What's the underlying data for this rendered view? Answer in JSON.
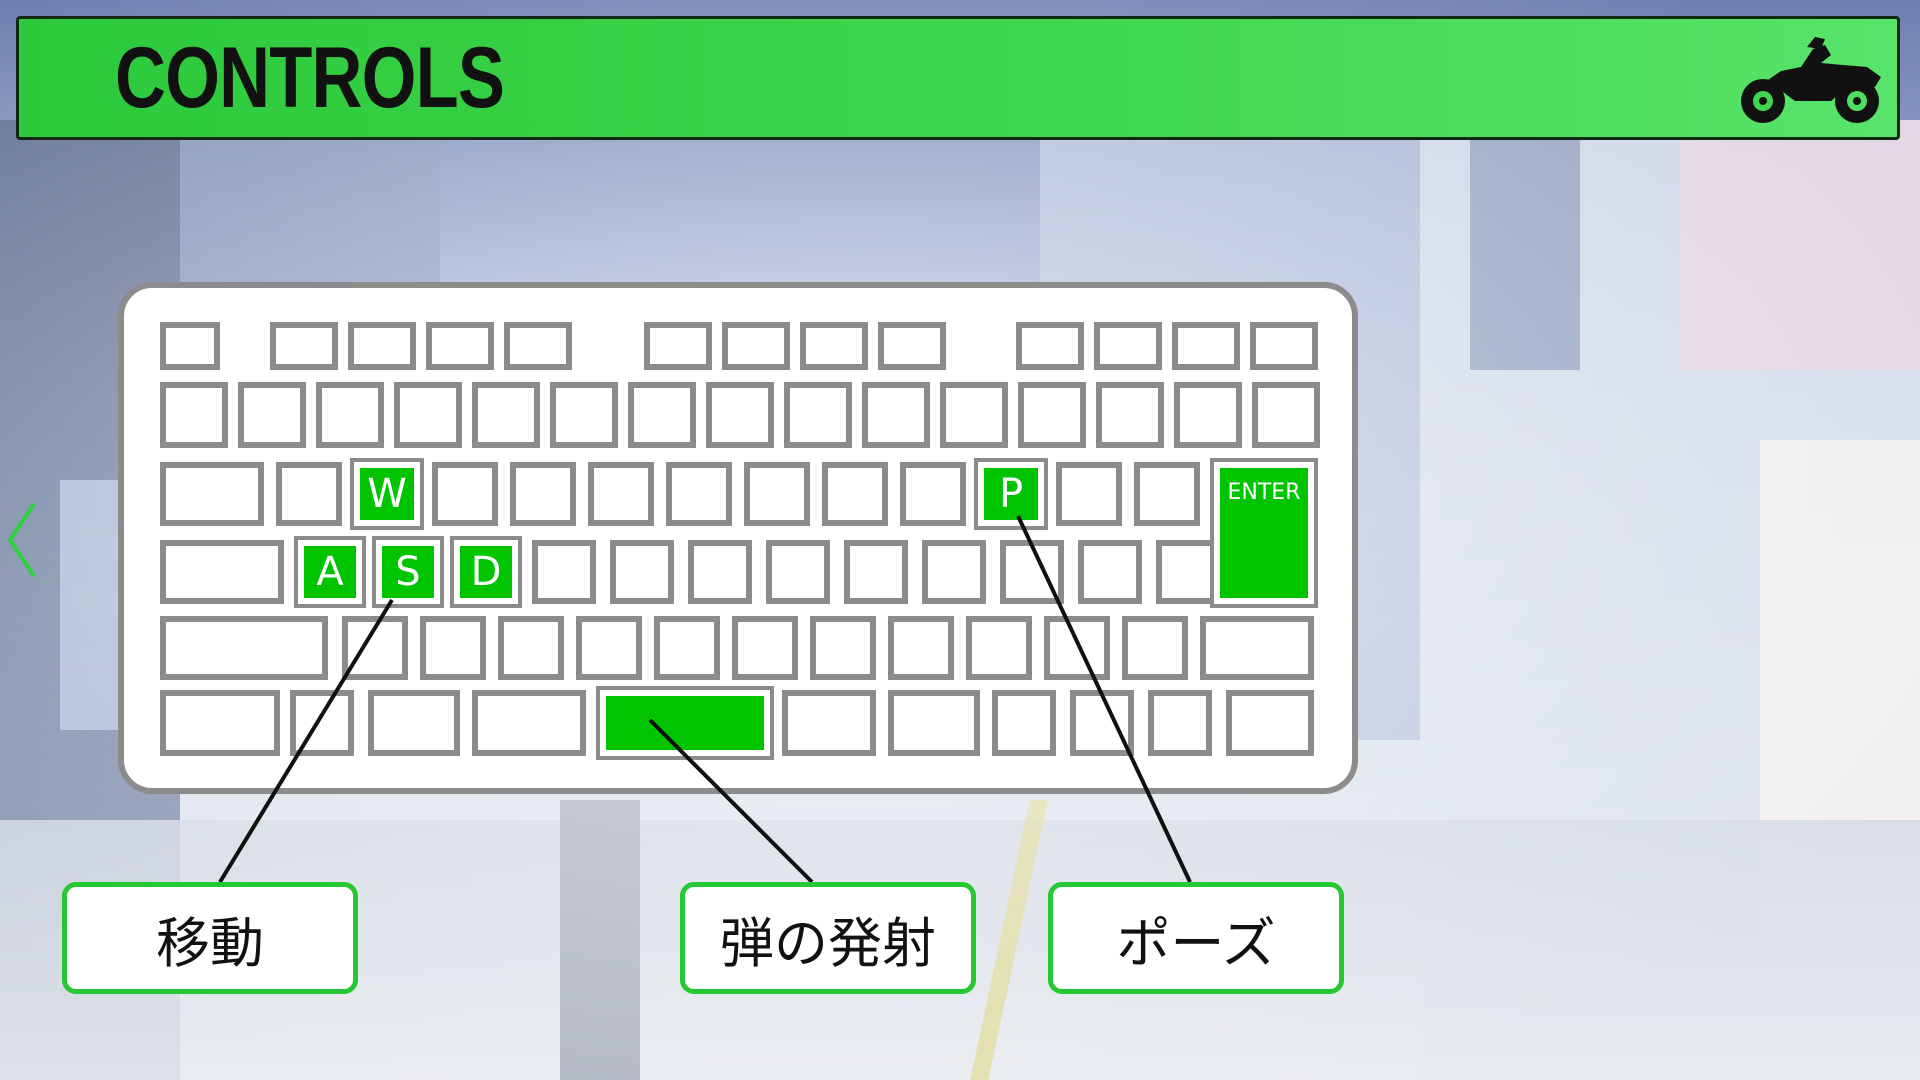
{
  "header": {
    "title": "CONTROLS",
    "icon": "motorcycle-icon"
  },
  "nav": {
    "back_icon": "chevron-left-icon"
  },
  "keyboard": {
    "highlight_color": "#00c400",
    "key_border_color": "#8c8c8c",
    "keys": {
      "w": "W",
      "a": "A",
      "s": "S",
      "d": "D",
      "p": "P",
      "enter": "ENTER",
      "space": ""
    }
  },
  "labels": {
    "move": "移動",
    "fire": "弾の発射",
    "pause": "ポーズ"
  },
  "colors": {
    "header_green": "#3fd64d",
    "label_border": "#25c832"
  }
}
